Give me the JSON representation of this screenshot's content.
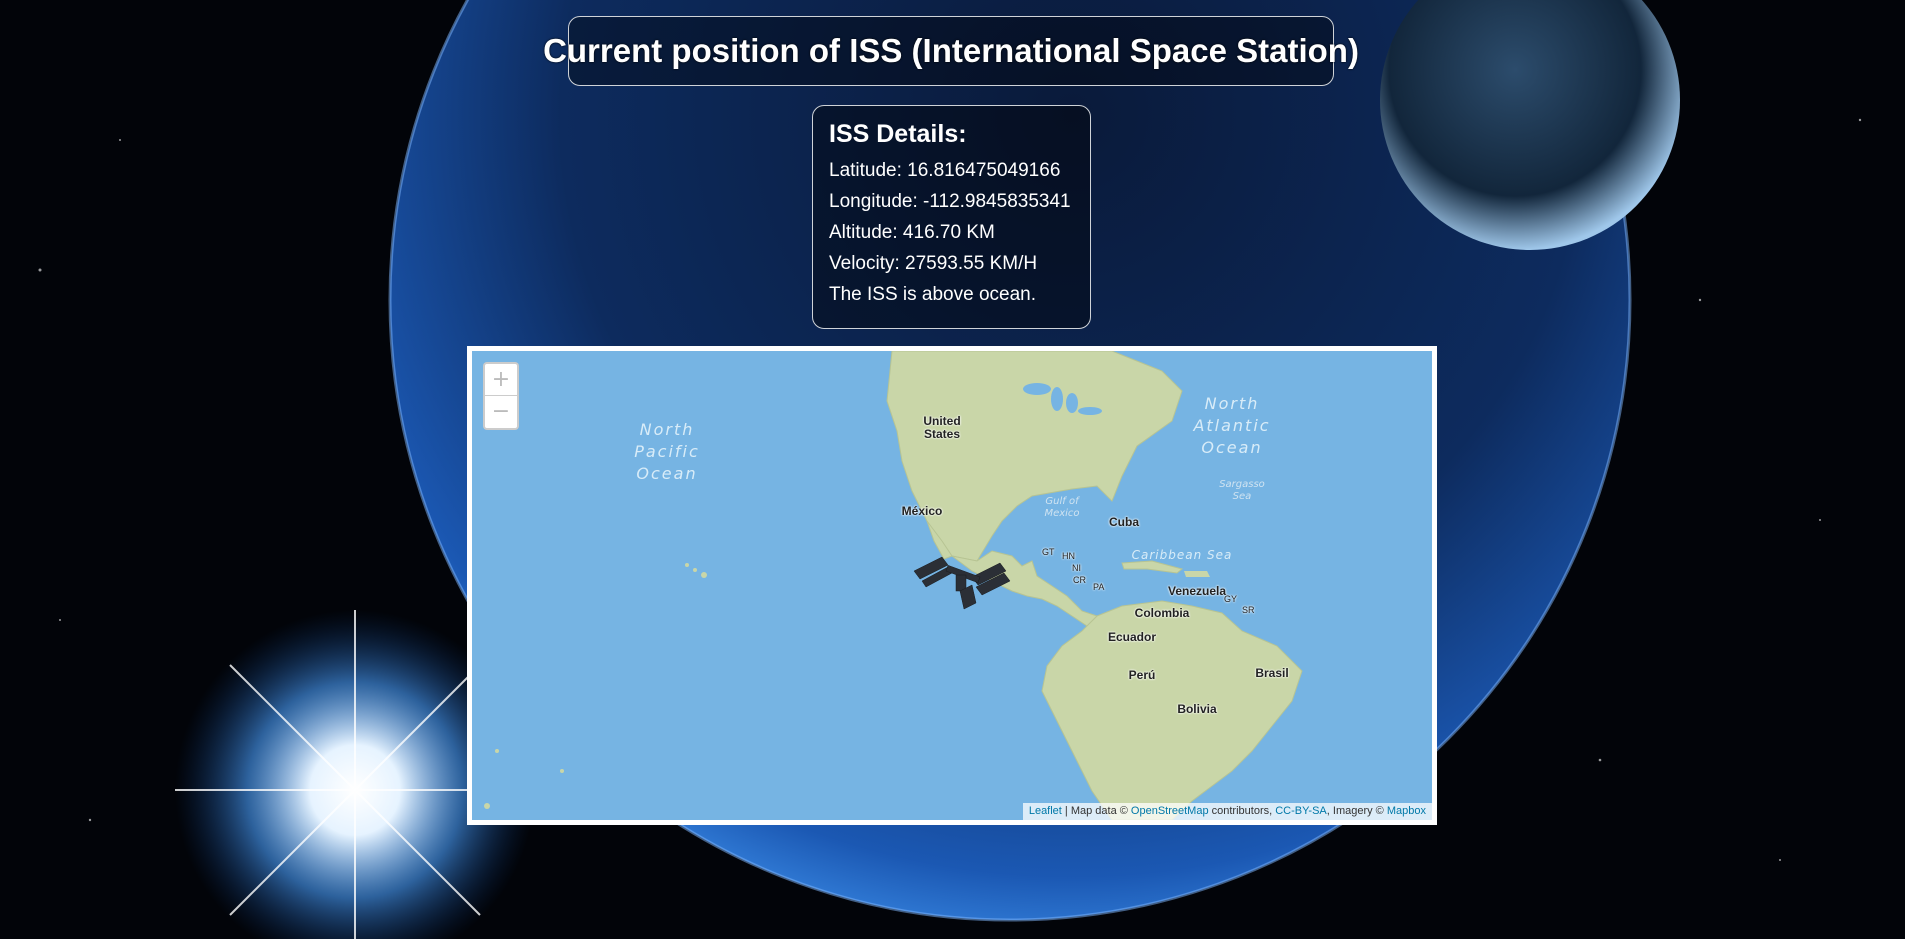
{
  "page_title": "Current position of ISS (International Space Station)",
  "details": {
    "heading": "ISS Details:",
    "latitude": "Latitude: 16.816475049166",
    "longitude": "Longitude: -112.9845835341",
    "altitude": "Altitude: 416.70 KM",
    "velocity": "Velocity: 27593.55 KM/H",
    "location": "The ISS is above ocean."
  },
  "map": {
    "zoom_in": "+",
    "zoom_out": "−",
    "ocean_labels": {
      "north_pacific": [
        "North",
        "Pacific",
        "Ocean"
      ],
      "north_atlantic": [
        "North",
        "Atlantic",
        "Ocean"
      ],
      "gulf_of_mexico": [
        "Gulf of",
        "Mexico"
      ],
      "sargasso": [
        "Sargasso",
        "Sea"
      ],
      "caribbean": "Caribbean Sea"
    },
    "countries": {
      "us": [
        "United",
        "States"
      ],
      "mexico": "México",
      "cuba": "Cuba",
      "gt": "GT",
      "hn": "HN",
      "ni": "NI",
      "cr": "CR",
      "pa": "PA",
      "venezuela": "Venezuela",
      "colombia": "Colombia",
      "gy": "GY",
      "sr": "SR",
      "ecuador": "Ecuador",
      "peru": "Perú",
      "brasil": "Brasil",
      "bolivia": "Bolivia"
    },
    "attribution": {
      "leaflet": "Leaflet",
      "sep": " | Map data © ",
      "osm": "OpenStreetMap",
      "contributors": " contributors, ",
      "license": "CC-BY-SA",
      "imagery": ", Imagery © ",
      "mapbox": "Mapbox"
    },
    "colors": {
      "ocean": "#76b4e3",
      "land": "#c9d6a8",
      "link": "#0078a8"
    }
  }
}
